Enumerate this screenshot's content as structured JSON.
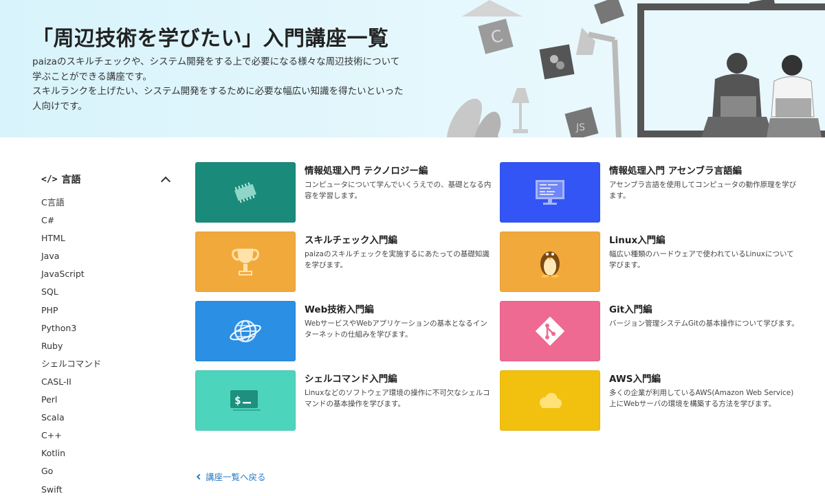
{
  "hero": {
    "title": "「周辺技術を学びたい」入門講座一覧",
    "desc_lines": [
      "paizaのスキルチェックや、システム開発をする上で必要になる様々な周辺技術について",
      "学ぶことができる講座です。",
      "スキルランクを上げたい、システム開発をするために必要な幅広い知識を得たいといった",
      "人向けです。"
    ]
  },
  "sidebar": {
    "heading": "言語",
    "items": [
      "C言語",
      "C#",
      "HTML",
      "Java",
      "JavaScript",
      "SQL",
      "PHP",
      "Python3",
      "Ruby",
      "シェルコマンド",
      "CASL-II",
      "Perl",
      "Scala",
      "C++",
      "Kotlin",
      "Go",
      "Swift"
    ]
  },
  "cards": [
    {
      "title": "情報処理入門 テクノロジー編",
      "desc": "コンピュータについて学んでいくうえでの、基礎となる内容を学習します。",
      "color": "#1a8a7a",
      "icon": "chip-icon"
    },
    {
      "title": "情報処理入門 アセンブラ言語編",
      "desc": "アセンブラ言語を使用してコンピュータの動作原理を学びます。",
      "color": "#3355f5",
      "icon": "monitor-code-icon"
    },
    {
      "title": "スキルチェック入門編",
      "desc": "paizaのスキルチェックを実施するにあたっての基礎知識を学びます。",
      "color": "#f2a93b",
      "icon": "trophy-icon"
    },
    {
      "title": "Linux入門編",
      "desc": "幅広い種類のハードウェアで使われているLinuxについて学びます。",
      "color": "#f2a93b",
      "icon": "penguin-icon"
    },
    {
      "title": "Web技術入門編",
      "desc": "WebサービスやWebアプリケーションの基本となるインターネットの仕組みを学びます。",
      "color": "#2b8fe3",
      "icon": "globe-icon"
    },
    {
      "title": "Git入門編",
      "desc": "バージョン管理システムGitの基本操作について学びます。",
      "color": "#ee6a93",
      "icon": "git-icon"
    },
    {
      "title": "シェルコマンド入門編",
      "desc": "Linuxなどのソフトウェア環境の操作に不可欠なシェルコマンドの基本操作を学びます。",
      "color": "#4dd4bd",
      "icon": "terminal-icon"
    },
    {
      "title": "AWS入門編",
      "desc": "多くの企業が利用しているAWS(Amazon Web Service)上にWebサーバの環境を構築する方法を学びます。",
      "color": "#f2c10f",
      "icon": "cloud-icon"
    }
  ],
  "back_link": "講座一覧へ戻る"
}
